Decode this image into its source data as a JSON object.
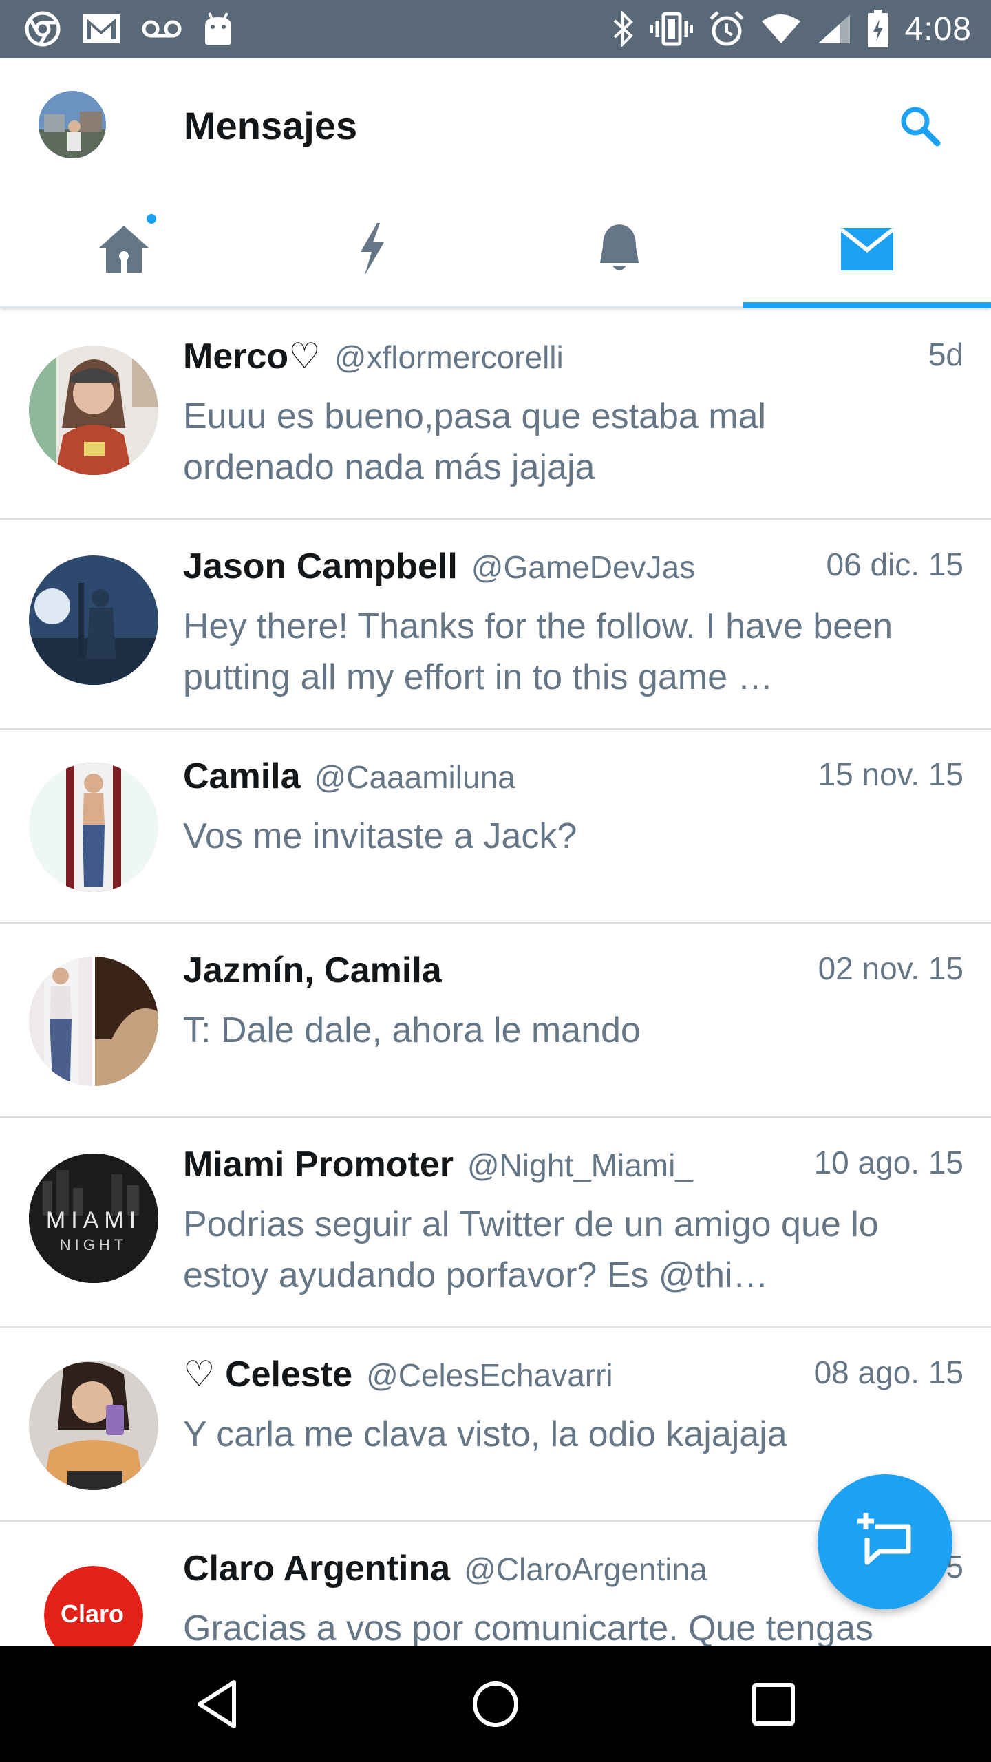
{
  "status_bar": {
    "time": "4:08",
    "left_icons": [
      "chrome-icon",
      "gmail-icon",
      "voicemail-icon",
      "android-icon"
    ],
    "right_icons": [
      "bluetooth-icon",
      "vibrate-icon",
      "alarm-icon",
      "wifi-icon",
      "signal-icon",
      "battery-icon"
    ]
  },
  "header": {
    "title": "Mensajes"
  },
  "tabs": [
    {
      "name": "home",
      "icon": "home-icon",
      "active": false,
      "has_dot": true
    },
    {
      "name": "moments",
      "icon": "lightning-icon",
      "active": false
    },
    {
      "name": "notifications",
      "icon": "bell-icon",
      "active": false
    },
    {
      "name": "messages",
      "icon": "mail-icon",
      "active": true
    }
  ],
  "colors": {
    "accent": "#1da1f2",
    "status_bar": "#5a6977",
    "text_secondary": "#657786",
    "icon_inactive": "#657786"
  },
  "conversations": [
    {
      "name": "Merco♡",
      "handle": "@xflormercorelli",
      "time": "5d",
      "preview": "Euuu es bueno,pasa que estaba mal ordenado nada más jajaja"
    },
    {
      "name": "Jason Campbell",
      "handle": "@GameDevJas",
      "time": "06 dic. 15",
      "preview": "Hey there! Thanks for the follow. I have been putting all my effort in to this game …"
    },
    {
      "name": "Camila",
      "handle": "@Caaamiluna",
      "time": "15 nov. 15",
      "preview": "Vos me invitaste a Jack?"
    },
    {
      "name": "Jazmín, Camila",
      "handle": "",
      "time": "02 nov. 15",
      "preview": "T: Dale dale, ahora le mando"
    },
    {
      "name": "Miami Promoter",
      "handle": "@Night_Miami_",
      "time": "10 ago. 15",
      "preview": "Podrias seguir al Twitter de un amigo que lo estoy ayudando porfavor? Es @thi…",
      "avatar_text_1": "MIAMI",
      "avatar_text_2": "NIGHT"
    },
    {
      "name": "♡ Celeste",
      "handle": "@CelesEchavarri",
      "time": "08 ago. 15",
      "preview": "Y carla me clava visto, la odio kajajaja"
    },
    {
      "name": "Claro Argentina",
      "handle": "@ClaroArgentina",
      "time": "5",
      "preview": "Gracias a vos por comunicarte. Que tengas",
      "avatar_text_1": "Claro"
    }
  ]
}
